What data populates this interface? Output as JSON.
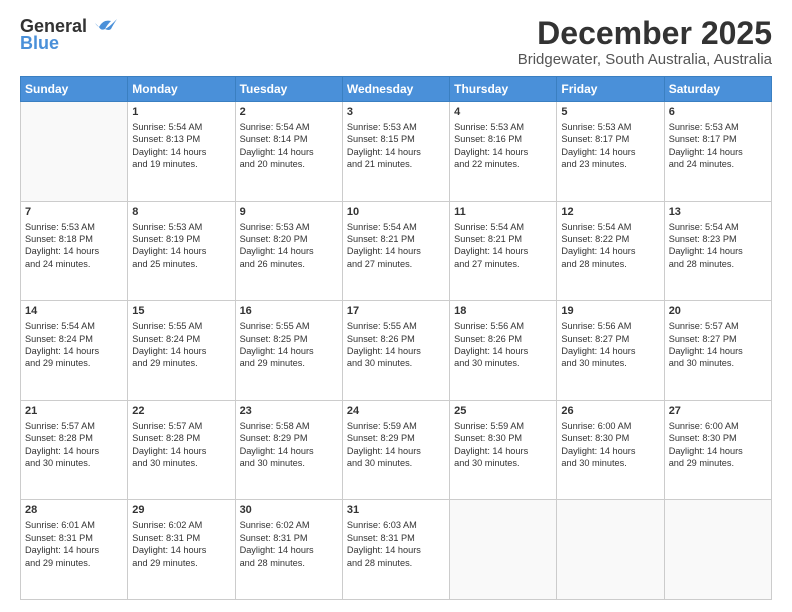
{
  "logo": {
    "general": "General",
    "blue": "Blue"
  },
  "header": {
    "month": "December 2025",
    "location": "Bridgewater, South Australia, Australia"
  },
  "weekdays": [
    "Sunday",
    "Monday",
    "Tuesday",
    "Wednesday",
    "Thursday",
    "Friday",
    "Saturday"
  ],
  "weeks": [
    [
      {
        "day": "",
        "content": ""
      },
      {
        "day": "1",
        "content": "Sunrise: 5:54 AM\nSunset: 8:13 PM\nDaylight: 14 hours\nand 19 minutes."
      },
      {
        "day": "2",
        "content": "Sunrise: 5:54 AM\nSunset: 8:14 PM\nDaylight: 14 hours\nand 20 minutes."
      },
      {
        "day": "3",
        "content": "Sunrise: 5:53 AM\nSunset: 8:15 PM\nDaylight: 14 hours\nand 21 minutes."
      },
      {
        "day": "4",
        "content": "Sunrise: 5:53 AM\nSunset: 8:16 PM\nDaylight: 14 hours\nand 22 minutes."
      },
      {
        "day": "5",
        "content": "Sunrise: 5:53 AM\nSunset: 8:17 PM\nDaylight: 14 hours\nand 23 minutes."
      },
      {
        "day": "6",
        "content": "Sunrise: 5:53 AM\nSunset: 8:17 PM\nDaylight: 14 hours\nand 24 minutes."
      }
    ],
    [
      {
        "day": "7",
        "content": "Sunrise: 5:53 AM\nSunset: 8:18 PM\nDaylight: 14 hours\nand 24 minutes."
      },
      {
        "day": "8",
        "content": "Sunrise: 5:53 AM\nSunset: 8:19 PM\nDaylight: 14 hours\nand 25 minutes."
      },
      {
        "day": "9",
        "content": "Sunrise: 5:53 AM\nSunset: 8:20 PM\nDaylight: 14 hours\nand 26 minutes."
      },
      {
        "day": "10",
        "content": "Sunrise: 5:54 AM\nSunset: 8:21 PM\nDaylight: 14 hours\nand 27 minutes."
      },
      {
        "day": "11",
        "content": "Sunrise: 5:54 AM\nSunset: 8:21 PM\nDaylight: 14 hours\nand 27 minutes."
      },
      {
        "day": "12",
        "content": "Sunrise: 5:54 AM\nSunset: 8:22 PM\nDaylight: 14 hours\nand 28 minutes."
      },
      {
        "day": "13",
        "content": "Sunrise: 5:54 AM\nSunset: 8:23 PM\nDaylight: 14 hours\nand 28 minutes."
      }
    ],
    [
      {
        "day": "14",
        "content": "Sunrise: 5:54 AM\nSunset: 8:24 PM\nDaylight: 14 hours\nand 29 minutes."
      },
      {
        "day": "15",
        "content": "Sunrise: 5:55 AM\nSunset: 8:24 PM\nDaylight: 14 hours\nand 29 minutes."
      },
      {
        "day": "16",
        "content": "Sunrise: 5:55 AM\nSunset: 8:25 PM\nDaylight: 14 hours\nand 29 minutes."
      },
      {
        "day": "17",
        "content": "Sunrise: 5:55 AM\nSunset: 8:26 PM\nDaylight: 14 hours\nand 30 minutes."
      },
      {
        "day": "18",
        "content": "Sunrise: 5:56 AM\nSunset: 8:26 PM\nDaylight: 14 hours\nand 30 minutes."
      },
      {
        "day": "19",
        "content": "Sunrise: 5:56 AM\nSunset: 8:27 PM\nDaylight: 14 hours\nand 30 minutes."
      },
      {
        "day": "20",
        "content": "Sunrise: 5:57 AM\nSunset: 8:27 PM\nDaylight: 14 hours\nand 30 minutes."
      }
    ],
    [
      {
        "day": "21",
        "content": "Sunrise: 5:57 AM\nSunset: 8:28 PM\nDaylight: 14 hours\nand 30 minutes."
      },
      {
        "day": "22",
        "content": "Sunrise: 5:57 AM\nSunset: 8:28 PM\nDaylight: 14 hours\nand 30 minutes."
      },
      {
        "day": "23",
        "content": "Sunrise: 5:58 AM\nSunset: 8:29 PM\nDaylight: 14 hours\nand 30 minutes."
      },
      {
        "day": "24",
        "content": "Sunrise: 5:59 AM\nSunset: 8:29 PM\nDaylight: 14 hours\nand 30 minutes."
      },
      {
        "day": "25",
        "content": "Sunrise: 5:59 AM\nSunset: 8:30 PM\nDaylight: 14 hours\nand 30 minutes."
      },
      {
        "day": "26",
        "content": "Sunrise: 6:00 AM\nSunset: 8:30 PM\nDaylight: 14 hours\nand 30 minutes."
      },
      {
        "day": "27",
        "content": "Sunrise: 6:00 AM\nSunset: 8:30 PM\nDaylight: 14 hours\nand 29 minutes."
      }
    ],
    [
      {
        "day": "28",
        "content": "Sunrise: 6:01 AM\nSunset: 8:31 PM\nDaylight: 14 hours\nand 29 minutes."
      },
      {
        "day": "29",
        "content": "Sunrise: 6:02 AM\nSunset: 8:31 PM\nDaylight: 14 hours\nand 29 minutes."
      },
      {
        "day": "30",
        "content": "Sunrise: 6:02 AM\nSunset: 8:31 PM\nDaylight: 14 hours\nand 28 minutes."
      },
      {
        "day": "31",
        "content": "Sunrise: 6:03 AM\nSunset: 8:31 PM\nDaylight: 14 hours\nand 28 minutes."
      },
      {
        "day": "",
        "content": ""
      },
      {
        "day": "",
        "content": ""
      },
      {
        "day": "",
        "content": ""
      }
    ]
  ]
}
